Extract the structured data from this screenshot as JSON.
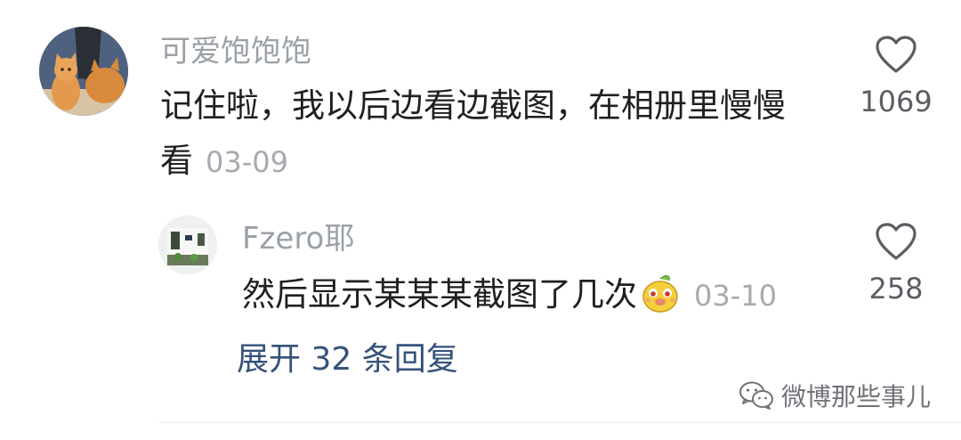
{
  "comment": {
    "username": "可爱饱饱饱",
    "text_line1": "记住啦，我以后边看边截图，在相册里慢慢",
    "text_line2": "看",
    "date": "03-09",
    "likes": "1069",
    "avatar_icon": "cat-avatar"
  },
  "reply": {
    "username": "Fzero耶",
    "text": "然后显示某某某截图了几次",
    "emoji_icon": "smiling-mascot-emoji",
    "date": "03-10",
    "likes": "258",
    "avatar_icon": "room-photo-avatar"
  },
  "expand": {
    "label": "展开 32 条回复"
  },
  "watermark": {
    "icon": "wechat-icon",
    "text": "微博那些事儿"
  },
  "colors": {
    "username": "#9aa0a6",
    "text": "#1f1f1f",
    "link": "#35527a",
    "date": "#a6aab0"
  }
}
